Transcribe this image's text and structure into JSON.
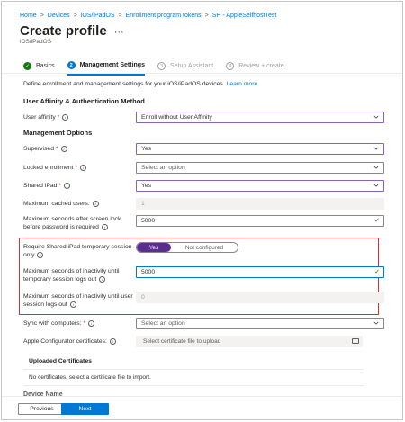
{
  "breadcrumb": [
    "Home",
    "Devices",
    "iOS/iPadOS",
    "Enrollment program tokens",
    "SH - AppleSelfhostTest"
  ],
  "title": "Create profile",
  "more_label": "···",
  "subtitle": "iOS/iPadOS",
  "steps": [
    {
      "num": "✓",
      "label": "Basics",
      "state": "done"
    },
    {
      "num": "2",
      "label": "Management Settings",
      "state": "active"
    },
    {
      "num": "3",
      "label": "Setup Assistant",
      "state": "pending"
    },
    {
      "num": "4",
      "label": "Review + create",
      "state": "pending"
    }
  ],
  "description": "Define enrollment and management settings for your iOS/iPadOS devices.",
  "learn_more": "Learn more.",
  "sections": {
    "user_affinity": "User Affinity & Authentication Method",
    "management_options": "Management Options"
  },
  "fields": {
    "user_affinity": {
      "label": "User affinity",
      "required": "*",
      "value": "Enroll without User Affinity"
    },
    "supervised": {
      "label": "Supervised",
      "required": "*",
      "value": "Yes"
    },
    "locked_enrollment": {
      "label": "Locked enrollment",
      "required": "*",
      "placeholder": "Select an option"
    },
    "shared_ipad": {
      "label": "Shared iPad",
      "required": "*",
      "value": "Yes"
    },
    "max_cached_users": {
      "label": "Maximum cached users:",
      "value": "1"
    },
    "max_seconds_lock": {
      "label": "Maximum seconds after screen lock before password is required",
      "value": "5000"
    },
    "temp_session": {
      "label": "Require Shared iPad temporary session only",
      "on": "Yes",
      "off": "Not configured"
    },
    "inactivity_temp": {
      "label": "Maximum seconds of inactivity until temporary session logs out",
      "value": "5000"
    },
    "inactivity_user": {
      "label": "Maximum seconds of inactivity until user session logs out",
      "value": "0"
    },
    "sync_computers": {
      "label": "Sync with computers:",
      "required": "*",
      "placeholder": "Select an option"
    },
    "configurator_certs": {
      "label": "Apple Configurator certificates:",
      "placeholder": "Select certificate file to upload"
    }
  },
  "uploaded": {
    "header": "Uploaded Certificates",
    "empty": "No certificates, select a certificate file to import."
  },
  "cutoff_label": "Device Name",
  "footer": {
    "previous": "Previous",
    "next": "Next"
  },
  "colors": {
    "accent": "#0078d4",
    "toggle_on": "#5c2d91",
    "highlight_box": "#d13438",
    "dropdown_border": "#8764b8"
  }
}
